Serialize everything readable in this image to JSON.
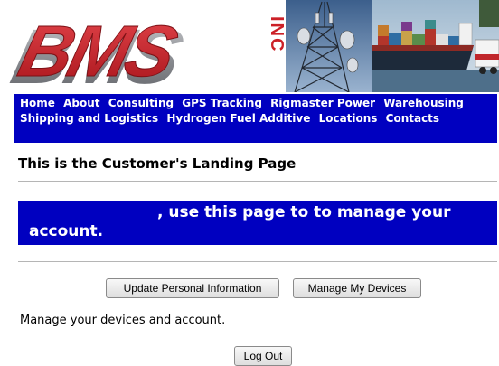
{
  "banner": {
    "logo_text": "BMS",
    "logo_suffix": "INC"
  },
  "nav": {
    "items": [
      "Home",
      "About",
      "Consulting",
      "GPS Tracking",
      "Rigmaster Power",
      "Warehousing",
      "Shipping and Logistics",
      "Hydrogen Fuel Additive",
      "Locations",
      "Contacts"
    ]
  },
  "main": {
    "title": "This is the Customer's Landing Page",
    "welcome_line1": ", use this page to to manage your",
    "welcome_line2": "account.",
    "buttons": {
      "update": "Update Personal Information",
      "devices": "Manage My Devices",
      "logout": "Log Out"
    },
    "manage_text": "Manage your devices and account."
  },
  "colors": {
    "nav_bg": "#0000c0",
    "logo_red": "#cc2027",
    "logo_grey": "#8f9196"
  }
}
